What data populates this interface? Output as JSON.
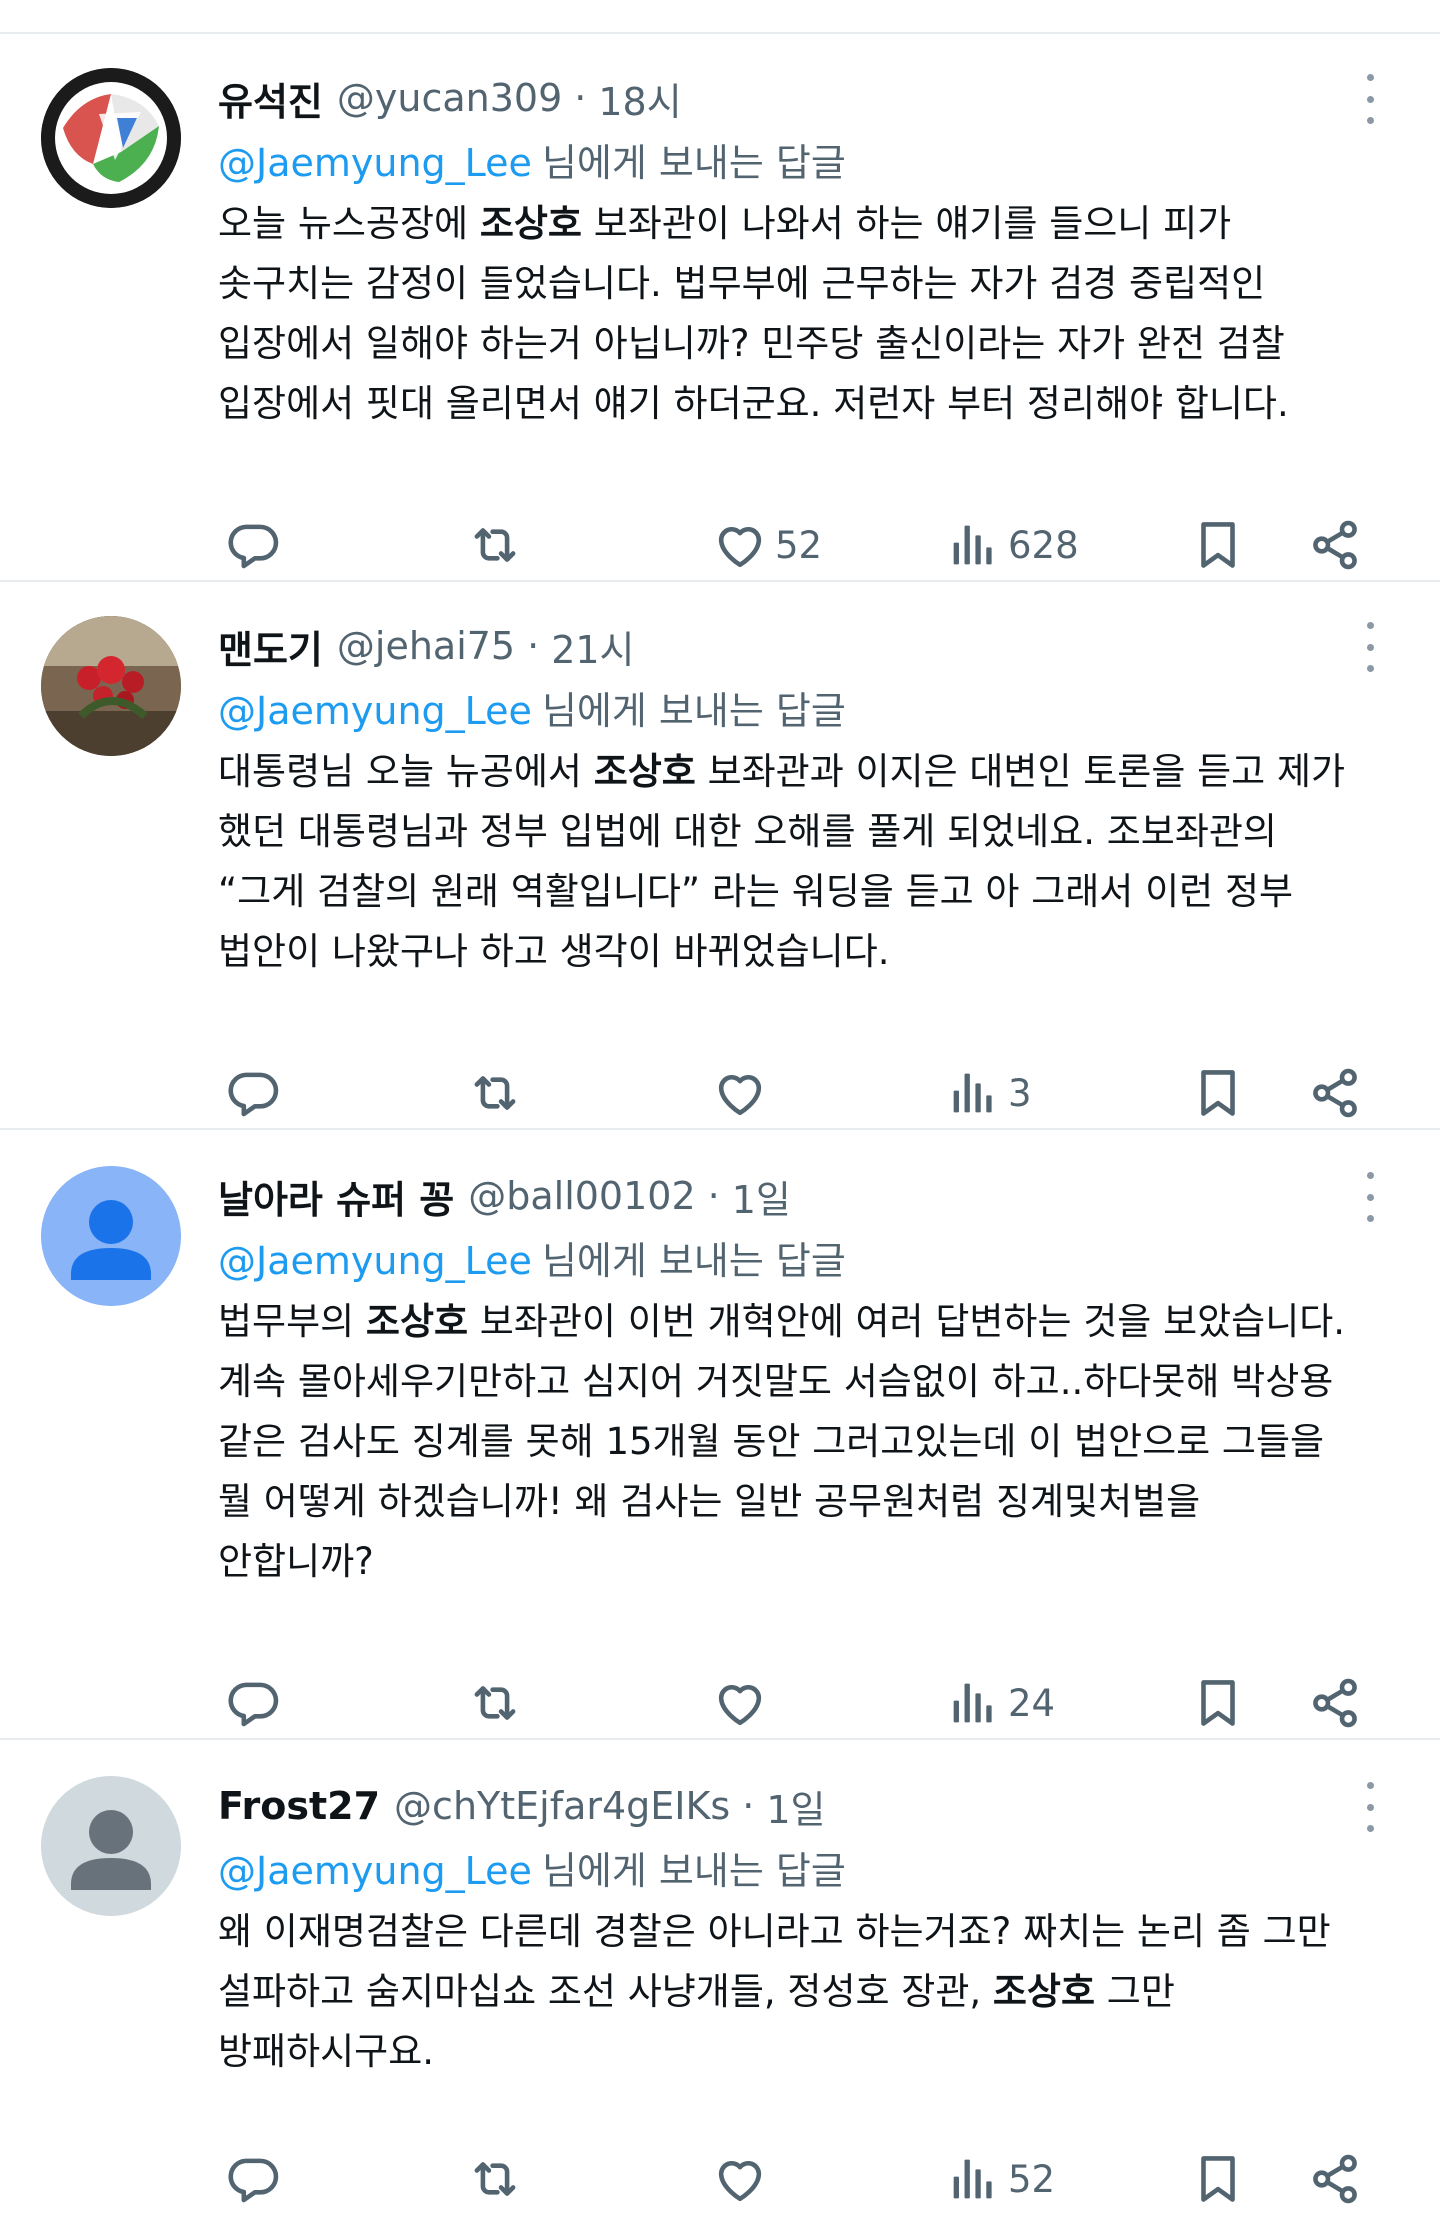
{
  "reply_to_prefix": "@Jaemyung_Lee",
  "reply_to_suffix": "님에게 보내는 답글",
  "tweets": [
    {
      "name": "유석진",
      "handle": "@yucan309",
      "time": "18시",
      "body": [
        [
          "오늘 뉴스공장에 ",
          "조상호",
          " 보좌관이 나와서 하는 얘기를 들으니 피가"
        ],
        [
          "솟구치는 감정이 들었습니다. 법무부에 근무하는 자가 검경 중립적인"
        ],
        [
          "입장에서 일해야 하는거 아닙니까? 민주당 출신이라는 자가 완전 검찰"
        ],
        [
          "입장에서 핏대 올리면서 얘기 하더군요. 저런자 부터 정리해야 합니다."
        ]
      ],
      "likes": "52",
      "views": "628"
    },
    {
      "name": "맨도기",
      "handle": "@jehai75",
      "time": "21시",
      "body": [
        [
          "대통령님 오늘 뉴공에서 ",
          "조상호",
          " 보좌관과 이지은 대변인 토론을 듣고 제가"
        ],
        [
          "했던 대통령님과 정부 입법에 대한 오해를 풀게 되었네요. 조보좌관의"
        ],
        [
          "“그게 검찰의 원래 역활입니다” 라는 워딩을 듣고 아 그래서 이런 정부"
        ],
        [
          "법안이 나왔구나 하고 생각이 바뀌었습니다."
        ]
      ],
      "likes": "",
      "views": "3"
    },
    {
      "name": "날아라 슈퍼 꽁",
      "handle": "@ball00102",
      "time": "1일",
      "body": [
        [
          "법무부의 ",
          "조상호",
          " 보좌관이 이번 개혁안에 여러 답변하는 것을 보았습니다."
        ],
        [
          "계속 몰아세우기만하고 심지어 거짓말도 서슴없이 하고..하다못해 박상용"
        ],
        [
          "같은 검사도 징계를 못해 15개월 동안 그러고있는데 이 법안으로 그들을"
        ],
        [
          "뭘 어떻게 하겠습니까! 왜 검사는 일반 공무원처럼 징계및처벌을"
        ],
        [
          "안합니까?"
        ]
      ],
      "likes": "",
      "views": "24"
    },
    {
      "name": "Frost27",
      "handle": "@chYtEjfar4gEIKs",
      "time": "1일",
      "body": [
        [
          "왜 이재명검찰은 다른데 경찰은 아니라고 하는거죠? 짜치는 논리 좀 그만"
        ],
        [
          "설파하고 숨지마십쇼 조선 사냥개들, 정성호 장관, ",
          "조상호",
          " 그만"
        ],
        [
          "방패하시구요."
        ]
      ],
      "likes": "",
      "views": "52"
    }
  ],
  "icons": {
    "reply": "reply-icon",
    "retweet": "retweet-icon",
    "like": "heart-icon",
    "views": "views-icon",
    "bookmark": "bookmark-icon",
    "share": "share-icon"
  },
  "colors": {
    "mention": "#1d9bf0",
    "secondary_text": "#536471",
    "icon": "#536471"
  }
}
